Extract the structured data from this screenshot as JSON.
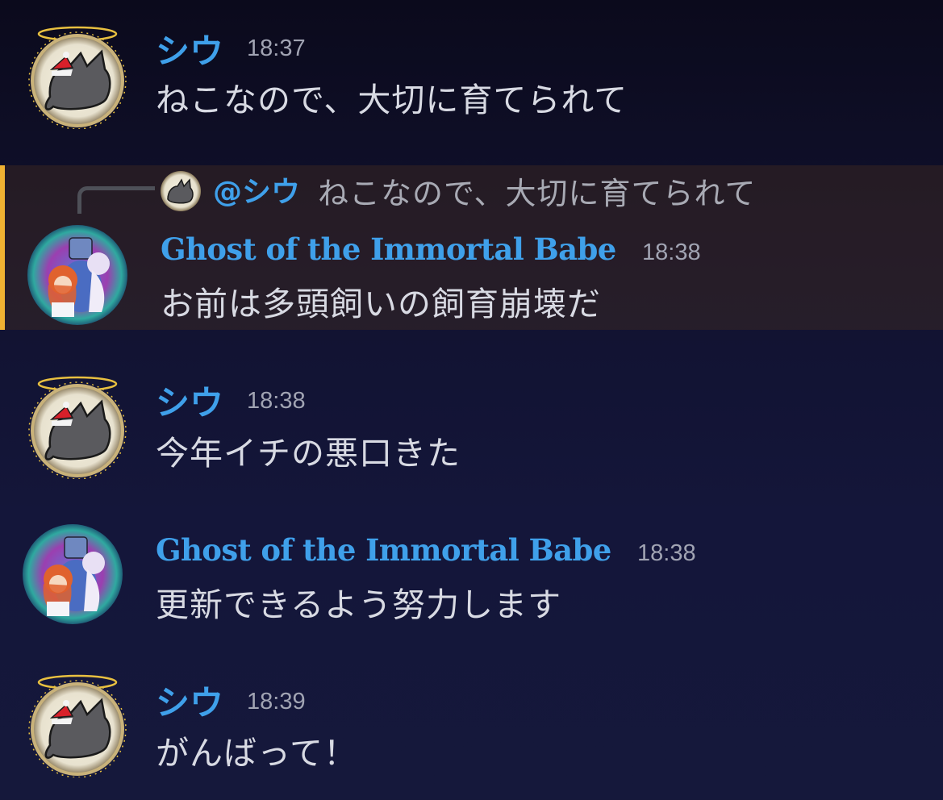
{
  "theme": {
    "username_color": "#3fa0ea",
    "highlight_bar_color": "#f0b232",
    "text_color": "#d8dae3",
    "timestamp_color": "#a1a4b3"
  },
  "messages": [
    {
      "author": "シウ",
      "avatar_icon": "cat-santa-hat-icon",
      "time": "18:37",
      "text": "ねこなので、大切に育てられて"
    },
    {
      "author": "Ghost of the Immortal Babe",
      "avatar_icon": "anime-characters-avatar-icon",
      "time": "18:38",
      "text": "お前は多頭飼いの飼育崩壊だ",
      "highlighted": true,
      "reply": {
        "mention": "@シウ",
        "text": "ねこなので、大切に育てられて",
        "avatar_icon": "cat-avatar-icon"
      }
    },
    {
      "author": "シウ",
      "avatar_icon": "cat-santa-hat-icon",
      "time": "18:38",
      "text": "今年イチの悪口きた"
    },
    {
      "author": "Ghost of the Immortal Babe",
      "avatar_icon": "anime-characters-avatar-icon",
      "time": "18:38",
      "text": "更新できるよう努力します"
    },
    {
      "author": "シウ",
      "avatar_icon": "cat-santa-hat-icon",
      "time": "18:39",
      "text": "がんばって！"
    }
  ]
}
